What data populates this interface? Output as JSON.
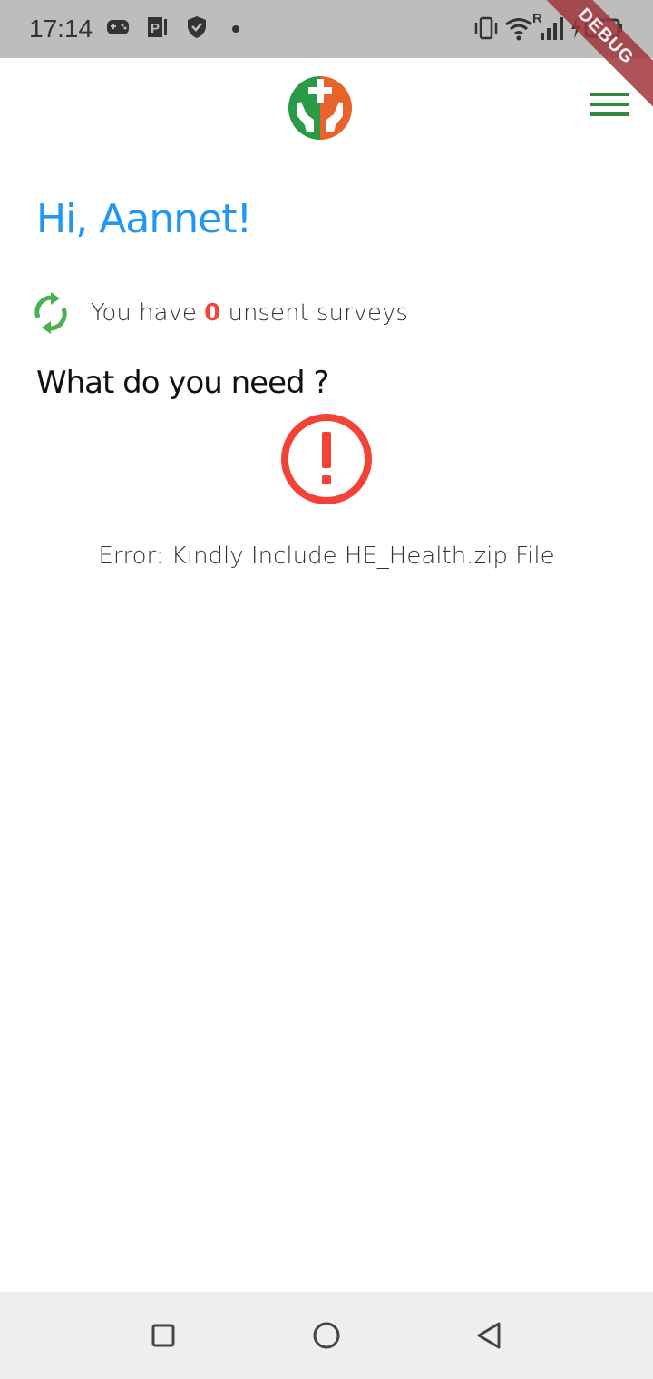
{
  "status_bar": {
    "time": "17:14",
    "icons": [
      "game-controller-icon",
      "parking-icon",
      "shield-icon",
      "dot-icon",
      "vibrate-icon",
      "wifi-icon",
      "signal-icon",
      "battery-charging-icon"
    ],
    "roaming_label": "R",
    "debug_label": "DEBUG"
  },
  "app_bar": {
    "logo": "health-hands-logo",
    "menu_icon": "hamburger-menu-icon"
  },
  "main": {
    "greeting": "Hi, Aannet!",
    "sync": {
      "prefix": "You have",
      "count": "0",
      "suffix": "unsent surveys"
    },
    "question": "What do you need ?",
    "error_message": "Error: Kindly Include HE_Health.zip File"
  },
  "nav_bar": {
    "buttons": [
      "recent-apps-button",
      "home-button",
      "back-button"
    ]
  },
  "colors": {
    "accent_blue": "#2196f3",
    "green": "#2e8b3b",
    "error_red": "#f44336",
    "logo_orange": "#e8632a",
    "logo_green": "#2a9a46"
  }
}
